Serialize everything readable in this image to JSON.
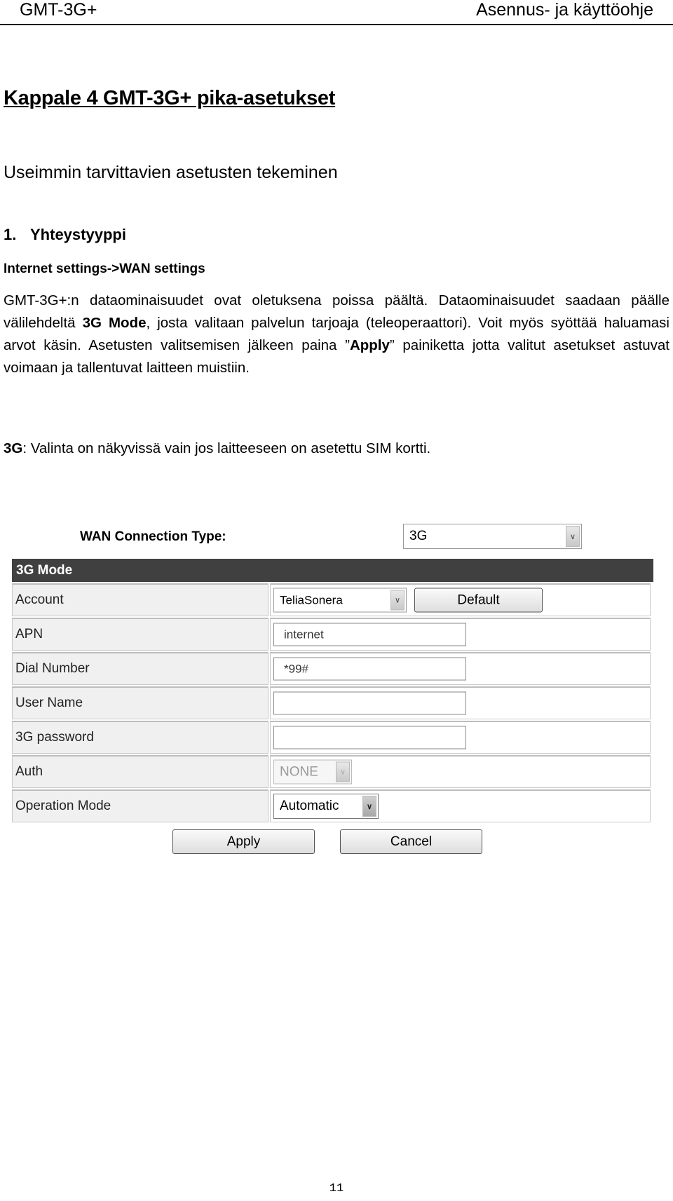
{
  "header": {
    "product": "GMT-3G+",
    "doc_title": "Asennus- ja käyttöohje"
  },
  "chapter_title": "Kappale 4 GMT-3G+ pika-asetukset",
  "subtitle": "Useimmin tarvittavien asetusten tekeminen",
  "section": {
    "number": "1.",
    "title": "Yhteystyyppi",
    "path": "Internet settings->WAN settings"
  },
  "paragraph": {
    "part1": "GMT-3G+:n dataominaisuudet ovat oletuksena poissa päältä. Dataominaisuudet saadaan päälle välilehdeltä ",
    "bold1": "3G Mode",
    "part2": ", josta valitaan palvelun tarjoaja (teleoperaattori). Voit myös syöttää haluamasi arvot käsin. Asetusten valitsemisen jälkeen paina ”",
    "bold2": "Apply",
    "part3": "” painiketta jotta valitut asetukset astuvat voimaan ja tallentuvat laitteen muistiin."
  },
  "note": {
    "bold": "3G",
    "text": ": Valinta on näkyvissä vain jos laitteeseen on asetettu SIM kortti."
  },
  "router_ui": {
    "wan_label": "WAN Connection Type:",
    "wan_value": "3G",
    "mode_header": "3G Mode",
    "rows": [
      {
        "label": "Account",
        "value": "TeliaSonera",
        "button": "Default"
      },
      {
        "label": "APN",
        "value": "internet"
      },
      {
        "label": "Dial Number",
        "value": "*99#"
      },
      {
        "label": "User Name",
        "value": ""
      },
      {
        "label": "3G password",
        "value": ""
      },
      {
        "label": "Auth",
        "value": "NONE"
      },
      {
        "label": "Operation Mode",
        "value": "Automatic"
      }
    ],
    "apply_label": "Apply",
    "cancel_label": "Cancel",
    "dropdown_glyph": "∨"
  },
  "page_number": "11"
}
